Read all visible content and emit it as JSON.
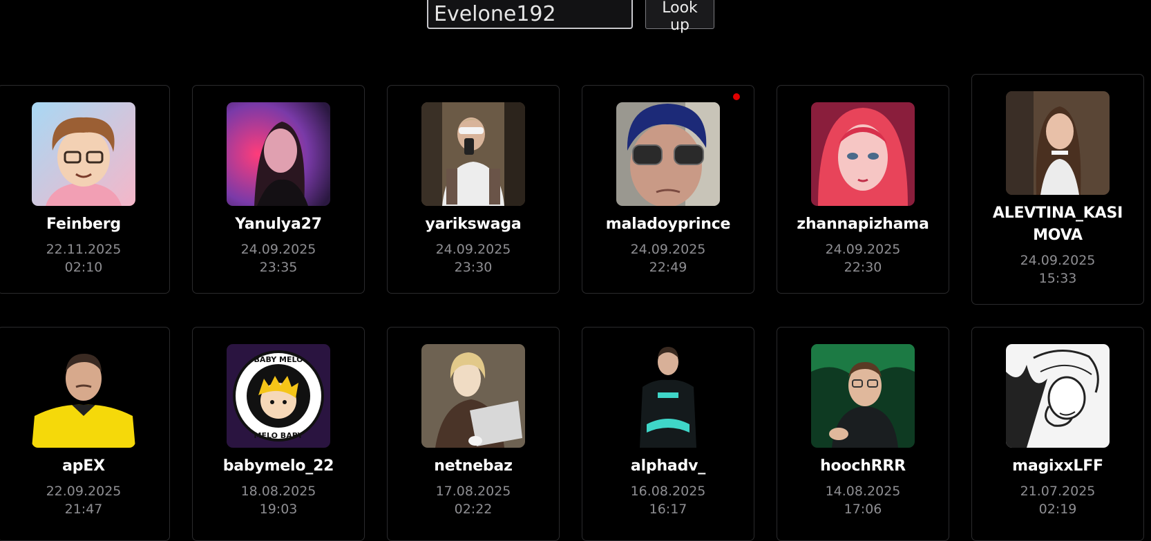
{
  "search": {
    "value": "Evelone192",
    "button_label": "Look up"
  },
  "colors": {
    "background": "#000000",
    "card_border": "#2b2b2d",
    "muted_text": "#8e8e92",
    "live_indicator": "#e00000"
  },
  "profiles": [
    {
      "username": "Feinberg",
      "date": "22.11.2025",
      "time": "02:10",
      "avatar": "cartoon-boy-avatar"
    },
    {
      "username": "Yanulya27",
      "date": "24.09.2025",
      "time": "23:35",
      "avatar": "girl-neon-light-avatar"
    },
    {
      "username": "yarikswaga",
      "date": "24.09.2025",
      "time": "23:30",
      "avatar": "mirror-selfie-avatar"
    },
    {
      "username": "maladoyprince",
      "date": "24.09.2025",
      "time": "22:49",
      "avatar": "blue-hair-sunglasses-avatar",
      "live": true
    },
    {
      "username": "zhannapizhama",
      "date": "24.09.2025",
      "time": "22:30",
      "avatar": "anime-girl-avatar"
    },
    {
      "username": "ALEVTINA_KASIMOVA",
      "username_lines": [
        "ALEVTINA_KASI",
        "MOVA"
      ],
      "date": "24.09.2025",
      "time": "15:33",
      "avatar": "girl-photo-avatar"
    },
    {
      "username": "apEX",
      "date": "22.09.2025",
      "time": "21:47",
      "avatar": "player-yellow-jersey-avatar"
    },
    {
      "username": "babymelo_22",
      "date": "18.08.2025",
      "time": "19:03",
      "avatar": "baby-melo-logo-avatar",
      "logo_text": [
        "BABY MELO",
        "MELO BABY"
      ]
    },
    {
      "username": "netnebaz",
      "date": "17.08.2025",
      "time": "02:22",
      "avatar": "anime-reading-avatar"
    },
    {
      "username": "alphadv_",
      "date": "16.08.2025",
      "time": "16:17",
      "avatar": "player-arms-crossed-avatar"
    },
    {
      "username": "hoochRRR",
      "date": "14.08.2025",
      "time": "17:06",
      "avatar": "player-pointing-avatar"
    },
    {
      "username": "magixxLFF",
      "date": "21.07.2025",
      "time": "02:19",
      "avatar": "manga-sketch-avatar"
    }
  ]
}
